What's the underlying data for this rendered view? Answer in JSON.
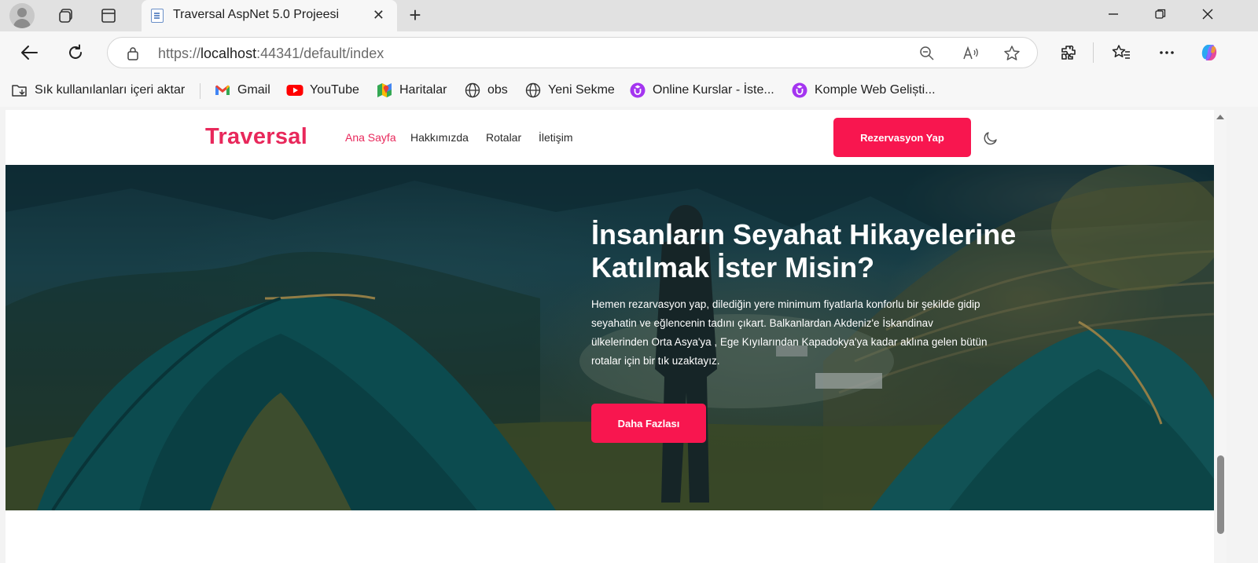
{
  "browser": {
    "tab": {
      "title": "Traversal AspNet 5.0 Projeesi",
      "close": "✕"
    },
    "new_tab": "+",
    "address": {
      "scheme": "https://",
      "host": "localhost",
      "rest": ":44341/default/index"
    },
    "bookmarks": [
      {
        "label": "Sık kullanılanları içeri aktar",
        "icon": "import-favorites-icon"
      },
      {
        "label": "Gmail",
        "icon": "gmail-icon"
      },
      {
        "label": "YouTube",
        "icon": "youtube-icon"
      },
      {
        "label": "Haritalar",
        "icon": "maps-icon"
      },
      {
        "label": "obs",
        "icon": "globe-icon"
      },
      {
        "label": "Yeni Sekme",
        "icon": "globe-icon"
      },
      {
        "label": "Online Kurslar - İste...",
        "icon": "udemy-icon"
      },
      {
        "label": "Komple Web Geliști...",
        "icon": "udemy-icon"
      }
    ],
    "colors": {
      "tab_strip": "#e1e1e1",
      "toolbar": "#f7f7f7"
    }
  },
  "site": {
    "logo": "Traversal",
    "menu": [
      "Ana Sayfa",
      "Hakkımızda",
      "Rotalar",
      "İletişim"
    ],
    "active_menu": "Ana Sayfa",
    "reserve_button": "Rezervasyon Yap",
    "theme_toggle_icon": "moon-icon",
    "hero": {
      "title": "İnsanların Seyahat Hikayelerine Katılmak İster Misin?",
      "text": "Hemen rezarvasyon yap, dilediğin yere minimum fiyatlarla konforlu bir şekilde gidip seyahatin ve eğlencenin tadını çıkart. Balkanlardan Akdeniz'e İskandinav ülkelerinden Orta Asya'ya , Ege Kıyılarından Kapadokya'ya kadar aklına gelen bütün rotalar için bir tık uzaktayız.",
      "button": "Daha Fazlası"
    },
    "colors": {
      "brand": "#e8285b",
      "button": "#f8164f"
    }
  }
}
